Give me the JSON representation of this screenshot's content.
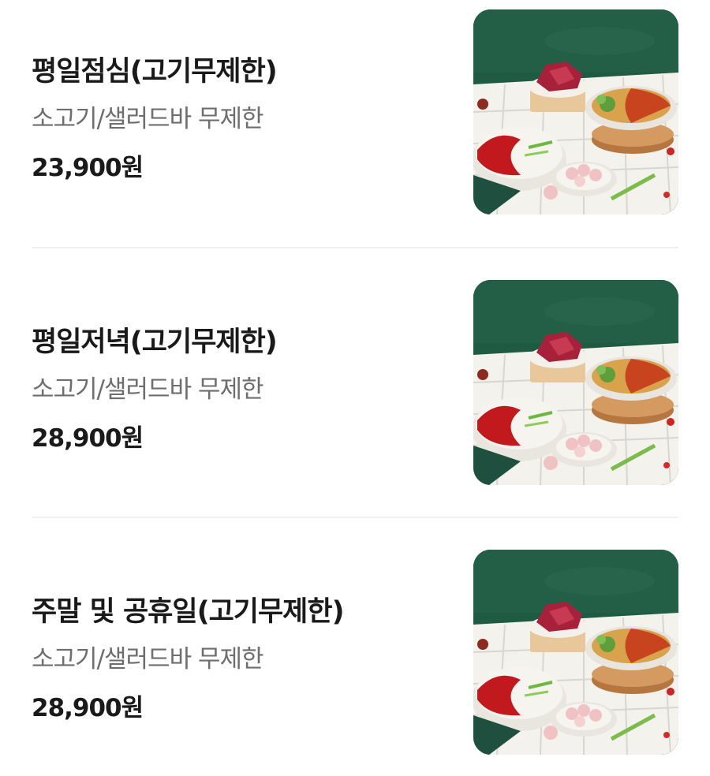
{
  "menu": {
    "items": [
      {
        "name": "평일점심(고기무제한)",
        "description": "소고기/샐러드바 무제한",
        "price": "23,900원"
      },
      {
        "name": "평일저녁(고기무제한)",
        "description": "소고기/샐러드바 무제한",
        "price": "28,900원"
      },
      {
        "name": "주말 및 공휴일(고기무제한)",
        "description": "소고기/샐러드바 무제한",
        "price": "28,900원"
      }
    ]
  },
  "colors": {
    "title": "#1a1a1a",
    "description": "#6e6e6e",
    "divider": "#f0f0f0",
    "thumb_background": "#1f5a43"
  }
}
